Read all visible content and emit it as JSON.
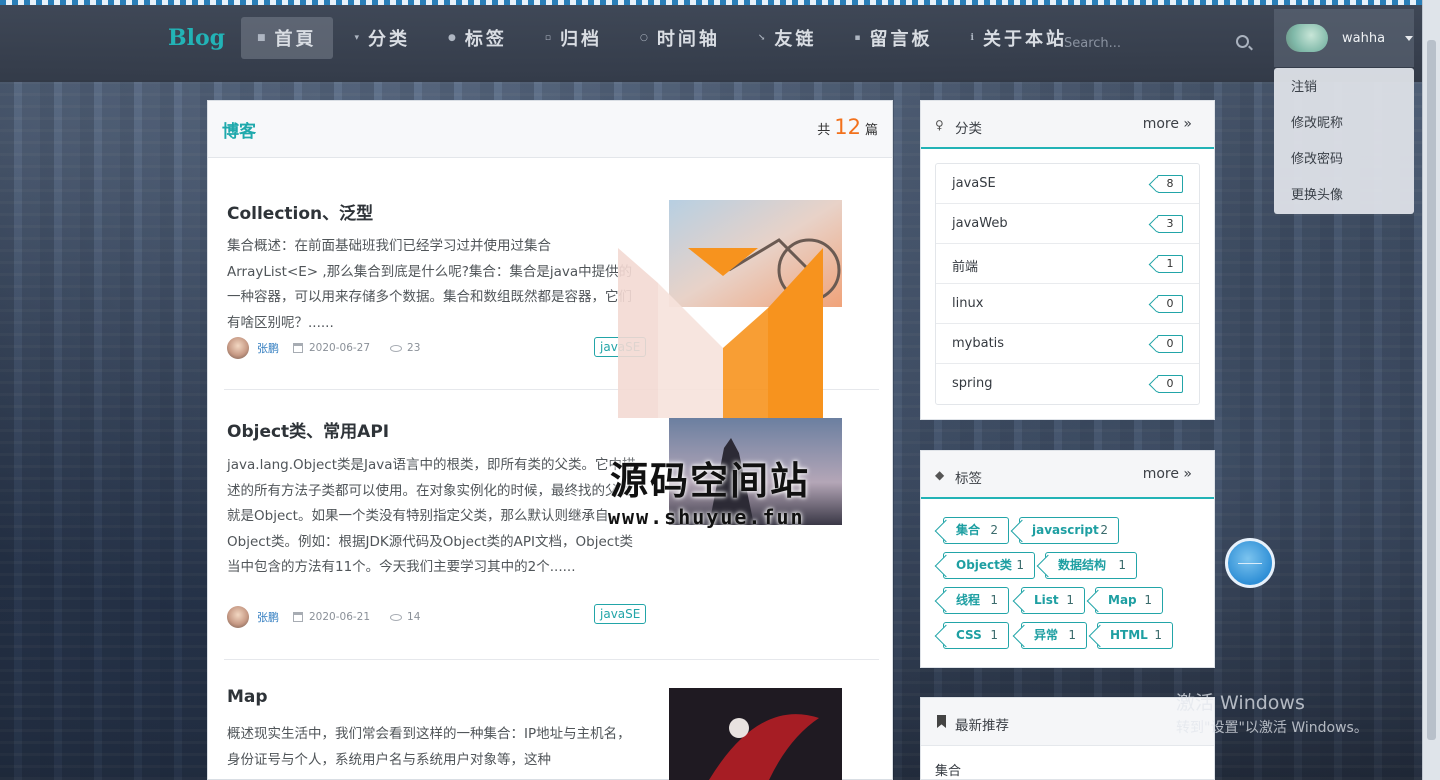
{
  "nav": {
    "brand": "Blog",
    "items": [
      {
        "label": "首頁",
        "active": true
      },
      {
        "label": "分类"
      },
      {
        "label": "标签"
      },
      {
        "label": "归档"
      },
      {
        "label": "时间轴"
      },
      {
        "label": "友链"
      },
      {
        "label": "留言板"
      },
      {
        "label": "关于本站"
      }
    ],
    "search_placeholder": "Search...",
    "username": "wahha"
  },
  "user_menu": [
    "注销",
    "修改昵称",
    "修改密码",
    "更换头像"
  ],
  "main": {
    "title": "博客",
    "count_prefix": "共",
    "count": "12",
    "count_suffix": "篇",
    "posts": [
      {
        "title": "Collection、泛型",
        "excerpt": "集合概述：在前面基础班我们已经学习过并使用过集合ArrayList<E> ,那么集合到底是什么呢?集合：集合是java中提供的一种容器，可以用来存储多个数据。集合和数组既然都是容器，它们有啥区别呢？......",
        "author": "张鹏",
        "date": "2020-06-27",
        "views": "23",
        "tag": "javaSE"
      },
      {
        "title": "Object类、常用API",
        "excerpt": "java.lang.Object类是Java语言中的根类，即所有类的父类。它中描述的所有方法子类都可以使用。在对象实例化的时候，最终找的父类就是Object。如果一个类没有特别指定父类，那么默认则继承自Object类。例如：根据JDK源代码及Object类的API文档，Object类当中包含的方法有11个。今天我们主要学习其中的2个......",
        "author": "张鹏",
        "date": "2020-06-21",
        "views": "14",
        "tag": "javaSE"
      },
      {
        "title": "Map",
        "excerpt": "概述现实生活中，我们常会看到这样的一种集合：IP地址与主机名，身份证号与个人，系统用户名与系统用户对象等，这种"
      }
    ]
  },
  "categories": {
    "title": "分类",
    "more": "more",
    "items": [
      {
        "name": "javaSE",
        "count": "8"
      },
      {
        "name": "javaWeb",
        "count": "3"
      },
      {
        "name": "前端",
        "count": "1"
      },
      {
        "name": "linux",
        "count": "0"
      },
      {
        "name": "mybatis",
        "count": "0"
      },
      {
        "name": "spring",
        "count": "0"
      }
    ]
  },
  "tags": {
    "title": "标签",
    "more": "more",
    "items": [
      {
        "name": "集合",
        "count": "2"
      },
      {
        "name": "javascript",
        "count": "2"
      },
      {
        "name": "Object类",
        "count": "1"
      },
      {
        "name": "数据结构",
        "count": "1"
      },
      {
        "name": "线程",
        "count": "1"
      },
      {
        "name": "List",
        "count": "1"
      },
      {
        "name": "Map",
        "count": "1"
      },
      {
        "name": "CSS",
        "count": "1"
      },
      {
        "name": "异常",
        "count": "1"
      },
      {
        "name": "HTML",
        "count": "1"
      }
    ]
  },
  "recommend": {
    "title": "最新推荐",
    "first": "集合"
  },
  "overlay": {
    "cn": "源码空间站",
    "url": "www.shuyue.fun"
  },
  "windows_watermark": {
    "line1": "激活 Windows",
    "line2": "转到\"设置\"以激活 Windows。"
  },
  "colors": {
    "accent": "#22b3b6",
    "count_orange": "#f2711c",
    "logo_orange": "#f7931e",
    "logo_pink": "#f3d9d3"
  }
}
